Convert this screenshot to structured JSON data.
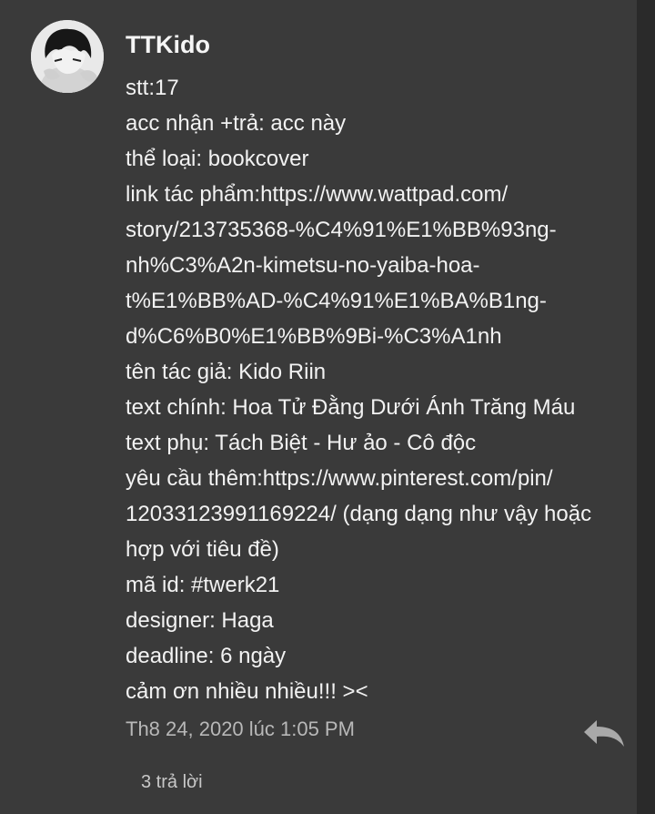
{
  "comment": {
    "author": "TTKido",
    "lines": [
      "stt:17",
      "acc nhận +trả: acc này",
      "thể loại: bookcover",
      "link tác phẩm:https://www.wattpad.com/",
      "story/213735368-%C4%91%E1%BB%93ng-",
      "nh%C3%A2n-kimetsu-no-yaiba-hoa-",
      "t%E1%BB%AD-%C4%91%E1%BA%B1ng-",
      "d%C6%B0%E1%BB%9Bi-%C3%A1nh",
      "tên tác giả: Kido Riin",
      "text chính: Hoa Tử Đằng Dưới Ánh Trăng Máu",
      "text phụ: Tách Biệt - Hư ảo - Cô độc",
      "yêu cầu thêm:https://www.pinterest.com/pin/",
      "12033123991169224/ (dạng dạng như vậy hoặc",
      "hợp với tiêu đề)",
      "mã id: #twerk21",
      "designer: Haga",
      "deadline: 6 ngày",
      "cảm ơn nhiều nhiều!!! ><"
    ],
    "timestamp": "Th8 24, 2020 lúc 1:05 PM",
    "reply_count_label": "3 trả lời",
    "reply_icon": "reply-arrow-icon"
  },
  "colors": {
    "background": "#3a3a3a",
    "text": "#f2f2f2",
    "muted_text": "#b8b8b8",
    "icon": "#a9a9a9"
  }
}
